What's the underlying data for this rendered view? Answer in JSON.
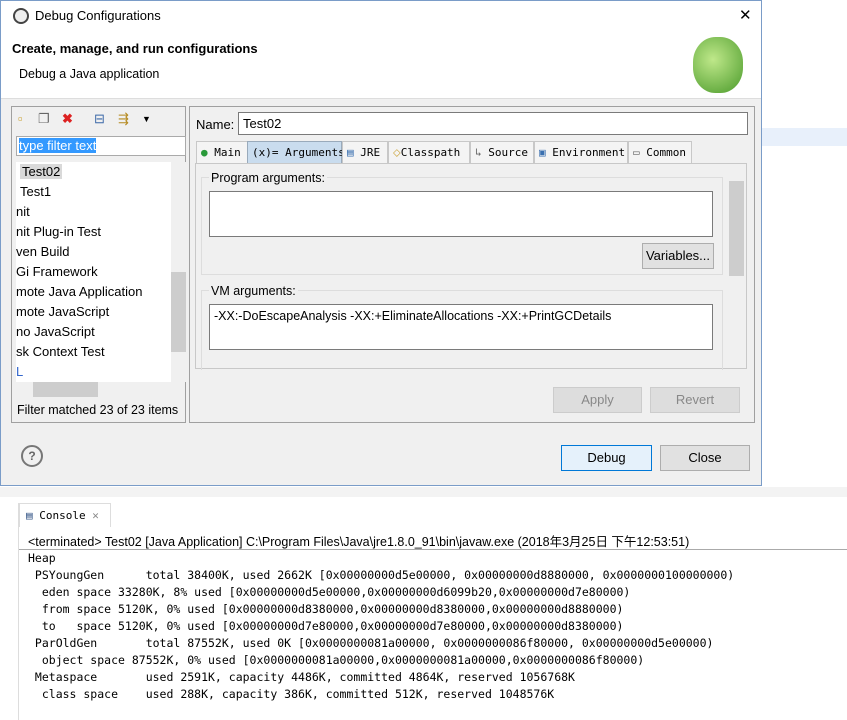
{
  "window": {
    "title": "Debug Configurations",
    "close": "✕"
  },
  "header": {
    "title": "Create, manage, and run configurations",
    "subtitle": "Debug a Java application"
  },
  "left": {
    "filter_placeholder": "type filter text",
    "items": [
      "Test02",
      "Test1",
      "nit",
      "nit Plug-in Test",
      "ven Build",
      "Gi Framework",
      "mote Java Application",
      "mote JavaScript",
      "no JavaScript",
      "sk Context Test",
      "L"
    ],
    "status": "Filter matched 23 of 23 items"
  },
  "right": {
    "name_label": "Name:",
    "name_value": "Test02",
    "tabs": [
      "Main",
      "Arguments",
      "JRE",
      "Classpath",
      "Source",
      "Environment",
      "Common"
    ],
    "program_args_label": "Program arguments:",
    "program_args": "",
    "variables": "Variables...",
    "vm_args_label": "VM arguments:",
    "vm_args": "-XX:-DoEscapeAnalysis -XX:+EliminateAllocations  -XX:+PrintGCDetails",
    "apply": "Apply",
    "revert": "Revert"
  },
  "footer": {
    "help": "?",
    "debug": "Debug",
    "close": "Close"
  },
  "console": {
    "tab": "Console",
    "status": "<terminated> Test02 [Java Application] C:\\Program Files\\Java\\jre1.8.0_91\\bin\\javaw.exe (2018年3月25日 下午12:53:51)",
    "lines": [
      "Heap",
      " PSYoungGen      total 38400K, used 2662K [0x00000000d5e00000, 0x00000000d8880000, 0x0000000100000000)",
      "  eden space 33280K, 8% used [0x00000000d5e00000,0x00000000d6099b20,0x00000000d7e80000)",
      "  from space 5120K, 0% used [0x00000000d8380000,0x00000000d8380000,0x00000000d8880000)",
      "  to   space 5120K, 0% used [0x00000000d7e80000,0x00000000d7e80000,0x00000000d8380000)",
      " ParOldGen       total 87552K, used 0K [0x0000000081a00000, 0x0000000086f80000, 0x00000000d5e00000)",
      "  object space 87552K, 0% used [0x0000000081a00000,0x0000000081a00000,0x0000000086f80000)",
      " Metaspace       used 2591K, capacity 4486K, committed 4864K, reserved 1056768K",
      "  class space    used 288K, capacity 386K, committed 512K, reserved 1048576K"
    ]
  }
}
